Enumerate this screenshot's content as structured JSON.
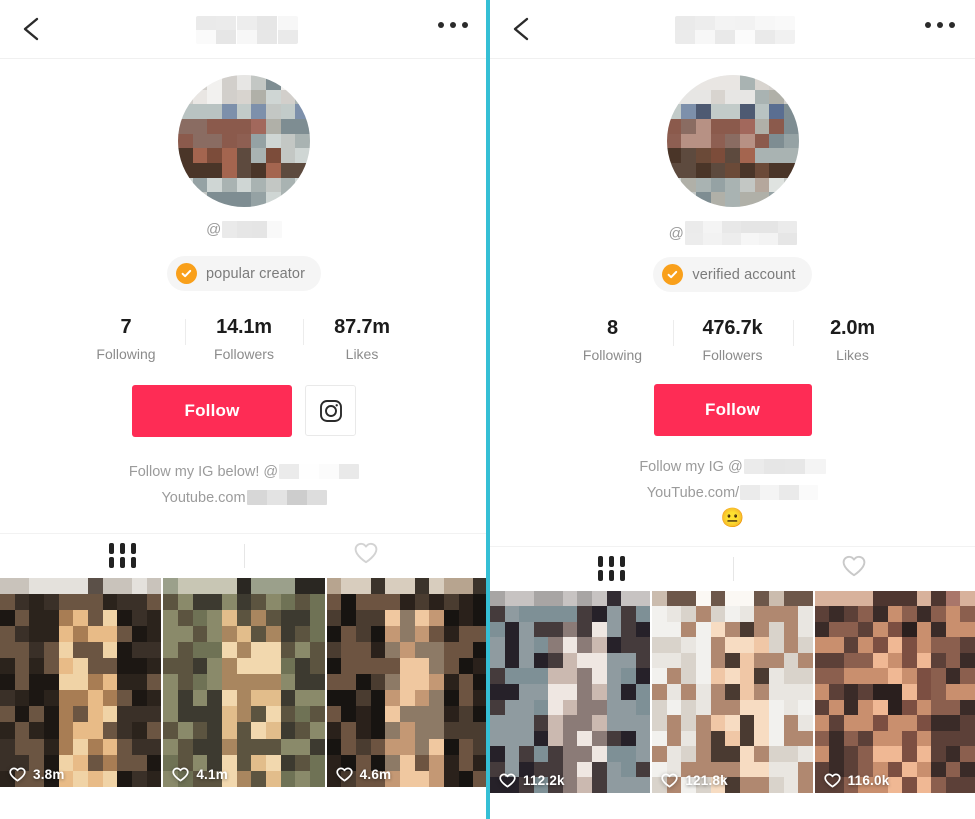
{
  "meta": {
    "layout": "two side-by-side mobile TikTok profile screenshots separated by a teal vertical divider",
    "accent_red": "#fe2c55",
    "badge_orange": "#f9a01b",
    "divider_teal": "#35bfd5"
  },
  "panels": [
    {
      "id": "left",
      "header": {
        "back_icon": "chevron-left-icon",
        "title": "",
        "title_redacted": true,
        "menu_icon": "more-options-icon"
      },
      "avatar": {
        "icon": "avatar-image",
        "redacted": true
      },
      "handle": {
        "prefix": "@",
        "value": "",
        "redacted": true
      },
      "badge": {
        "icon": "verified-check-icon",
        "label": "popular creator"
      },
      "stats": [
        {
          "value": "7",
          "label": "Following"
        },
        {
          "value": "14.1m",
          "label": "Followers"
        },
        {
          "value": "87.7m",
          "label": "Likes"
        }
      ],
      "actions": {
        "follow_label": "Follow",
        "instagram_icon": "instagram-icon",
        "has_instagram_button": true
      },
      "bio_lines": [
        {
          "text": "Follow my IG below! @",
          "redacted_tail": true,
          "blur_width": 80
        },
        {
          "text": "Youtube.com",
          "redacted_tail": true,
          "blur_width": 80
        }
      ],
      "bio_emoji": "",
      "tabs": [
        {
          "icon": "grid-posts-icon",
          "active": true
        },
        {
          "icon": "heart-liked-icon",
          "active": false
        }
      ],
      "videos": [
        {
          "likes": "3.8m",
          "like_icon": "heart-icon"
        },
        {
          "likes": "4.1m",
          "like_icon": "heart-icon"
        },
        {
          "likes": "4.6m",
          "like_icon": "heart-icon"
        }
      ]
    },
    {
      "id": "right",
      "header": {
        "back_icon": "chevron-left-icon",
        "title": "",
        "title_redacted": true,
        "menu_icon": "more-options-icon"
      },
      "avatar": {
        "icon": "avatar-image",
        "redacted": true
      },
      "handle": {
        "prefix": "@",
        "value": "",
        "redacted": true
      },
      "badge": {
        "icon": "verified-check-icon",
        "label": "verified account"
      },
      "stats": [
        {
          "value": "8",
          "label": "Following"
        },
        {
          "value": "476.7k",
          "label": "Followers"
        },
        {
          "value": "2.0m",
          "label": "Likes"
        }
      ],
      "actions": {
        "follow_label": "Follow",
        "instagram_icon": "instagram-icon",
        "has_instagram_button": false
      },
      "bio_lines": [
        {
          "text": "Follow my IG @",
          "redacted_tail": true,
          "blur_width": 82
        },
        {
          "text": "YouTube.com/",
          "redacted_tail": true,
          "blur_width": 78
        }
      ],
      "bio_emoji": "😐",
      "tabs": [
        {
          "icon": "grid-posts-icon",
          "active": true
        },
        {
          "icon": "heart-liked-icon",
          "active": false
        }
      ],
      "videos": [
        {
          "likes": "112.2k",
          "like_icon": "heart-icon"
        },
        {
          "likes": "121.8k",
          "like_icon": "heart-icon"
        },
        {
          "likes": "116.0k",
          "like_icon": "heart-icon"
        }
      ]
    }
  ]
}
